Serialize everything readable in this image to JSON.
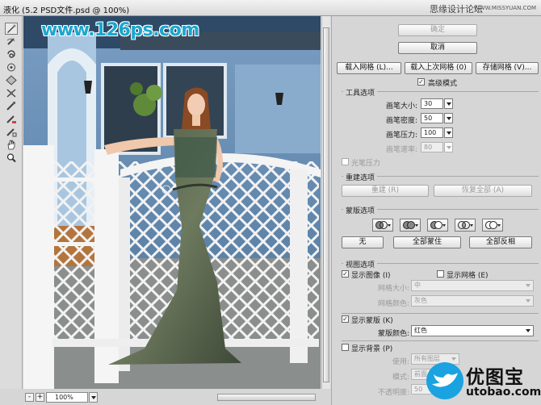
{
  "window": {
    "title": "液化 (5.2 PSD文件.psd @ 100%)",
    "brand": "思缘设计论坛",
    "brand_url": "WWW.MISSYUAN.COM"
  },
  "canvas": {
    "watermark": "www.126ps.com",
    "zoom": "100%",
    "zoom_minus": "-",
    "zoom_plus": "+"
  },
  "tools": [
    "forward-warp",
    "reconstruct",
    "twirl",
    "pucker",
    "bloat",
    "push-left",
    "mirror",
    "turbulence",
    "freeze-mask",
    "thaw-mask",
    "hand",
    "zoom"
  ],
  "buttons": {
    "ok": "确定",
    "cancel": "取消",
    "load_mesh": "载入网格 (L)...",
    "load_last_mesh": "载入上次网格 (0)",
    "save_mesh": "存储网格 (V)..."
  },
  "advanced_mode": {
    "label": "高级模式",
    "checked": true
  },
  "tool_options": {
    "title": "工具选项",
    "brush_size": {
      "label": "画笔大小:",
      "value": "30"
    },
    "brush_density": {
      "label": "画笔密度:",
      "value": "50"
    },
    "brush_pressure": {
      "label": "画笔压力:",
      "value": "100"
    },
    "brush_rate": {
      "label": "画笔速率:",
      "value": "80"
    },
    "stylus_pressure": "光笔压力"
  },
  "reconstruct": {
    "title": "重建选项",
    "reconstruct_button": "重建 (R)",
    "restore_all_button": "恢复全部 (A)"
  },
  "mask": {
    "title": "蒙版选项",
    "none_button": "无",
    "mask_all_button": "全部蒙住",
    "invert_all_button": "全部反相"
  },
  "view": {
    "title": "视图选项",
    "show_image": {
      "label": "显示图像 (I)",
      "checked": true
    },
    "show_mesh": {
      "label": "显示网格 (E)",
      "checked": false
    },
    "mesh_size": {
      "label": "网格大小:",
      "value": "中"
    },
    "mesh_color": {
      "label": "网格颜色:",
      "value": "灰色"
    }
  },
  "show_mask": {
    "label": "显示蒙版 (K)",
    "checked": true,
    "color_label": "蒙版颜色:",
    "color_value": "红色"
  },
  "show_backdrop": {
    "label": "显示背景 (P)",
    "checked": false,
    "use_label": "使用:",
    "use_value": "所有图层",
    "mode_label": "模式:",
    "mode_value": "前面",
    "opacity_label": "不透明度:",
    "opacity_value": "50"
  },
  "logo": {
    "cn": "优图宝",
    "en": "utobao.com",
    "colors": {
      "bird": "#1aa3e0"
    }
  }
}
